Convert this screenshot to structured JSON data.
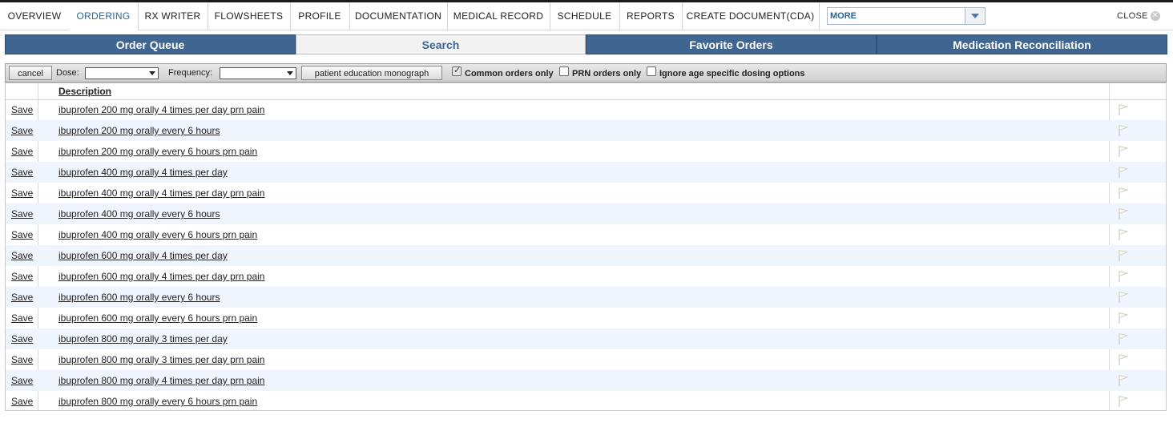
{
  "topnav": {
    "tabs": [
      {
        "label": "OVERVIEW",
        "active": false
      },
      {
        "label": "ORDERING",
        "active": true
      },
      {
        "label": "RX WRITER",
        "active": false
      },
      {
        "label": "FLOWSHEETS",
        "active": false
      },
      {
        "label": "PROFILE",
        "active": false
      },
      {
        "label": "DOCUMENTATION",
        "active": false
      },
      {
        "label": "MEDICAL RECORD",
        "active": false
      },
      {
        "label": "SCHEDULE",
        "active": false
      },
      {
        "label": "REPORTS",
        "active": false
      },
      {
        "label": "CREATE DOCUMENT(CDA)",
        "active": false
      }
    ],
    "more_value": "MORE",
    "close_label": "CLOSE"
  },
  "subtabs": [
    {
      "label": "Order Queue",
      "active": false
    },
    {
      "label": "Search",
      "active": true
    },
    {
      "label": "Favorite Orders",
      "active": false
    },
    {
      "label": "Medication Reconciliation",
      "active": false
    }
  ],
  "toolbar": {
    "cancel_label": "cancel",
    "dose_label": "Dose:",
    "frequency_label": "Frequency:",
    "monograph_label": "patient education monograph",
    "common_orders_label": "Common orders only",
    "prn_orders_label": "PRN orders only",
    "ignore_age_label": "Ignore age specific dosing options"
  },
  "table": {
    "header_description": "Description",
    "save_label": "Save",
    "rows": [
      "ibuprofen 200 mg orally 4 times per day prn pain",
      "ibuprofen 200 mg orally every 6 hours",
      "ibuprofen 200 mg orally every 6 hours prn pain",
      "ibuprofen 400 mg orally 4 times per day",
      "ibuprofen 400 mg orally 4 times per day prn pain",
      "ibuprofen 400 mg orally every 6 hours",
      "ibuprofen 400 mg orally every 6 hours prn pain",
      "ibuprofen 600 mg orally 4 times per day",
      "ibuprofen 600 mg orally 4 times per day prn pain",
      "ibuprofen 600 mg orally every 6 hours",
      "ibuprofen 600 mg orally every 6 hours prn pain",
      "ibuprofen 800 mg orally 3 times per day",
      "ibuprofen 800 mg orally 3 times per day prn pain",
      "ibuprofen 800 mg orally 4 times per day prn pain",
      "ibuprofen 800 mg orally every 6 hours prn pain"
    ]
  },
  "colors": {
    "tab_blue": "#3f6591",
    "active_link": "#2a6496",
    "row_alt": "#eef5fd"
  }
}
